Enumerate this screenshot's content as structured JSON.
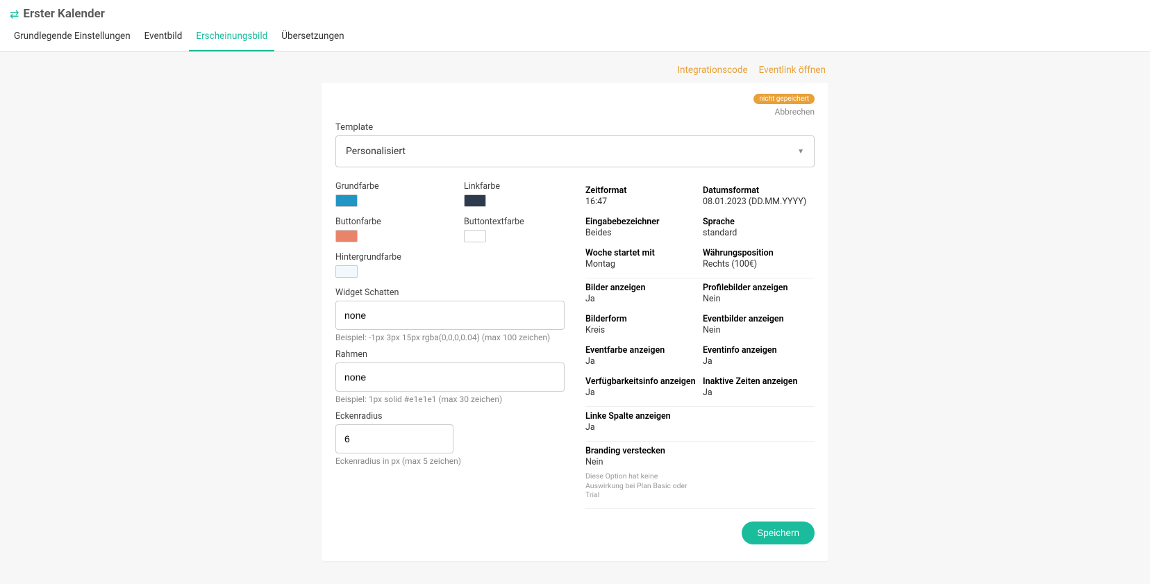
{
  "header": {
    "title": "Erster Kalender",
    "tabs": [
      {
        "label": "Grundlegende Einstellungen"
      },
      {
        "label": "Eventbild"
      },
      {
        "label": "Erscheinungsbild"
      },
      {
        "label": "Übersetzungen"
      }
    ]
  },
  "topLinks": {
    "integration": "Integrationscode",
    "eventlink": "Eventlink öffnen"
  },
  "card": {
    "badge": "nicht gepeichert",
    "cancel": "Abbrechen",
    "templateLabel": "Template",
    "templateValue": "Personalisiert",
    "colors": {
      "grundfarbe": {
        "label": "Grundfarbe",
        "hex": "#2196c4"
      },
      "linkfarbe": {
        "label": "Linkfarbe",
        "hex": "#2e3b4e"
      },
      "buttonfarbe": {
        "label": "Buttonfarbe",
        "hex": "#e9846a"
      },
      "buttontextfarbe": {
        "label": "Buttontextfarbe",
        "hex": "#ffffff"
      },
      "hintergrundfarbe": {
        "label": "Hintergrundfarbe",
        "hex": "#f2f8fb"
      }
    },
    "shadow": {
      "label": "Widget Schatten",
      "value": "none",
      "help": "Beispiel: -1px 3px 15px rgba(0,0,0,0.04) (max 100 zeichen)"
    },
    "border": {
      "label": "Rahmen",
      "value": "none",
      "help": "Beispiel: 1px solid #e1e1e1 (max 30 zeichen)"
    },
    "radius": {
      "label": "Eckenradius",
      "value": "6",
      "help": "Eckenradius in px (max 5 zeichen)"
    },
    "section1": {
      "timeformat": {
        "k": "Zeitformat",
        "v": "16:47"
      },
      "dateformat": {
        "k": "Datumsformat",
        "v": "08.01.2023 (DD.MM.YYYY)"
      },
      "inputlabel": {
        "k": "Eingabebezeichner",
        "v": "Beides"
      },
      "language": {
        "k": "Sprache",
        "v": "standard"
      },
      "weekstart": {
        "k": "Woche startet mit",
        "v": "Montag"
      },
      "currencypos": {
        "k": "Währungsposition",
        "v": "Rechts (100€)"
      }
    },
    "section2": {
      "showimages": {
        "k": "Bilder anzeigen",
        "v": "Ja"
      },
      "showprofile": {
        "k": "Profilebilder anzeigen",
        "v": "Nein"
      },
      "imageform": {
        "k": "Bilderform",
        "v": "Kreis"
      },
      "showeventimg": {
        "k": "Eventbilder anzeigen",
        "v": "Nein"
      },
      "showeventcolor": {
        "k": "Eventfarbe anzeigen",
        "v": "Ja"
      },
      "showeventinfo": {
        "k": "Eventinfo anzeigen",
        "v": "Ja"
      },
      "showavail": {
        "k": "Verfügbarkeitsinfo anzeigen",
        "v": "Ja"
      },
      "showinactive": {
        "k": "Inaktive Zeiten anzeigen",
        "v": "Ja"
      }
    },
    "section3": {
      "leftcol": {
        "k": "Linke Spalte anzeigen",
        "v": "Ja"
      }
    },
    "section4": {
      "branding": {
        "k": "Branding verstecken",
        "v": "Nein"
      },
      "brandingHint": "Diese Option hat keine Auswirkung bei Plan Basic oder Trial"
    },
    "save": "Speichern"
  }
}
